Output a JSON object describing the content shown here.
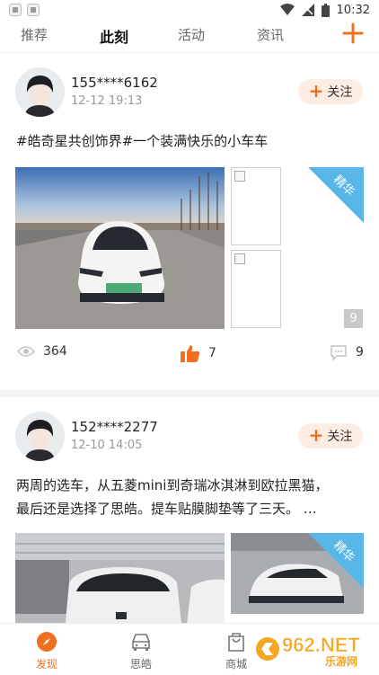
{
  "status_bar": {
    "time": "10:32"
  },
  "top_nav": {
    "tabs": [
      {
        "label": "推荐",
        "active": false
      },
      {
        "label": "此刻",
        "active": true
      },
      {
        "label": "活动",
        "active": false
      },
      {
        "label": "资讯",
        "active": false
      }
    ],
    "add_icon": "plus-icon"
  },
  "posts": [
    {
      "username": "155****6162",
      "time": "12-12 19:13",
      "follow_label": "关注",
      "text": "#皓奇星共创饰界#一个装满快乐的小车车",
      "badge": "精华",
      "image_count": "9",
      "views": "364",
      "likes": "7",
      "comments": "9"
    },
    {
      "username": "152****2277",
      "time": "12-10 14:05",
      "follow_label": "关注",
      "text_line1": "两周的选车，从五菱mini到奇瑞冰淇淋到欧拉黑猫，",
      "text_line2": "最后还是选择了思皓。提车贴膜脚垫等了三天。 …",
      "badge": "精华"
    }
  ],
  "bottom_nav": {
    "items": [
      {
        "label": "发现",
        "icon": "compass-icon",
        "active": true
      },
      {
        "label": "思皓",
        "icon": "car-icon",
        "active": false
      },
      {
        "label": "商城",
        "icon": "shopping-bag-icon",
        "active": false
      }
    ]
  },
  "watermark": {
    "text": "962.NET",
    "subtext": "乐游网"
  },
  "colors": {
    "accent": "#f07020",
    "badge_blue": "#59b7e8",
    "follow_bg": "#fdece2"
  }
}
